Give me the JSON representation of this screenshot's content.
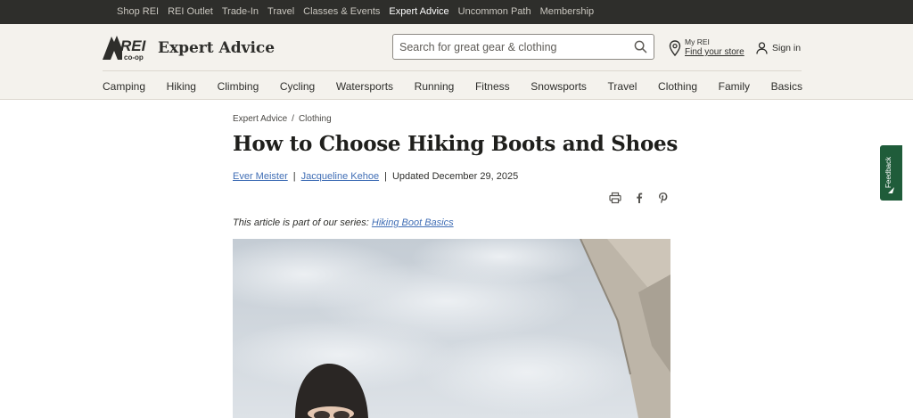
{
  "topbar": {
    "links": [
      {
        "label": "Shop REI",
        "active": false
      },
      {
        "label": "REI Outlet",
        "active": false
      },
      {
        "label": "Trade-In",
        "active": false
      },
      {
        "label": "Travel",
        "active": false
      },
      {
        "label": "Classes & Events",
        "active": false
      },
      {
        "label": "Expert Advice",
        "active": true
      },
      {
        "label": "Uncommon Path",
        "active": false
      },
      {
        "label": "Membership",
        "active": false
      }
    ]
  },
  "header": {
    "logo_icon": "rei-coop-logo",
    "title": "Expert Advice",
    "search_placeholder": "Search for great gear & clothing",
    "search_value": "",
    "store_label": "My REI",
    "store_link": "Find your store",
    "signin_label": "Sign in"
  },
  "categories": [
    "Camping",
    "Hiking",
    "Climbing",
    "Cycling",
    "Watersports",
    "Running",
    "Fitness",
    "Snowsports",
    "Travel",
    "Clothing",
    "Family",
    "Basics"
  ],
  "article": {
    "breadcrumb": [
      "Expert Advice",
      "Clothing"
    ],
    "breadcrumb_sep": "/",
    "title": "How to Choose Hiking Boots and Shoes",
    "authors": [
      "Ever Meister",
      "Jacqueline Kehoe"
    ],
    "byline_sep": "|",
    "updated": "Updated December 29, 2025",
    "share_icons": [
      "print-icon",
      "facebook-icon",
      "pinterest-icon"
    ],
    "series_text": "This article is part of our series: ",
    "series_link": "Hiking Boot Basics"
  },
  "feedback": {
    "label": "Feedback"
  },
  "colors": {
    "topbar_bg": "#2e2e2b",
    "header_bg": "#f4f2ed",
    "link_blue": "#406eb5",
    "feedback_green": "#1f5c3a"
  }
}
